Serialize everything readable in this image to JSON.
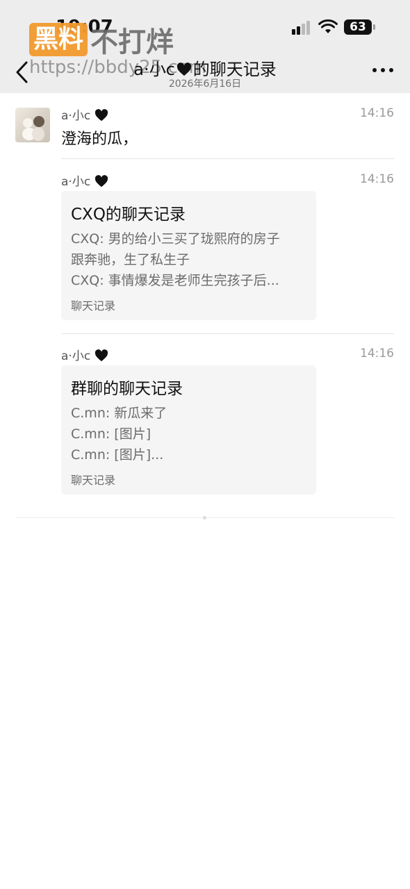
{
  "status_bar": {
    "time": "19:07",
    "battery": "63"
  },
  "watermark": {
    "badge": "黑料",
    "text": "不打烊",
    "url": "https://bbdy25.com"
  },
  "header": {
    "title_name": "a·小c",
    "title_suffix": "的聊天记录",
    "date": "2026年6月16日"
  },
  "messages": [
    {
      "sender": "a·小c",
      "time": "14:16",
      "text": "澄海的瓜，"
    },
    {
      "sender": "a·小c",
      "time": "14:16",
      "card": {
        "title": "CXQ的聊天记录",
        "lines": [
          "CXQ: 男的给小三买了珑熙府的房子",
          "跟奔驰，生了私生子",
          "CXQ: 事情爆发是老师生完孩子后..."
        ],
        "footer": "聊天记录"
      }
    },
    {
      "sender": "a·小c",
      "time": "14:16",
      "card": {
        "title": "群聊的聊天记录",
        "lines": [
          "C.mn: 新瓜来了",
          "C.mn: [图片]",
          "C.mn: [图片]..."
        ],
        "footer": "聊天记录"
      }
    }
  ],
  "colors": {
    "header_bg": "#ededed",
    "card_bg": "#f5f5f5",
    "watermark_orange": "#f29a2e",
    "heart": "#111111"
  },
  "icons": [
    "back-chevron-icon",
    "more-dots-icon",
    "black-heart-icon",
    "signal-icon",
    "wifi-icon",
    "battery-icon"
  ]
}
